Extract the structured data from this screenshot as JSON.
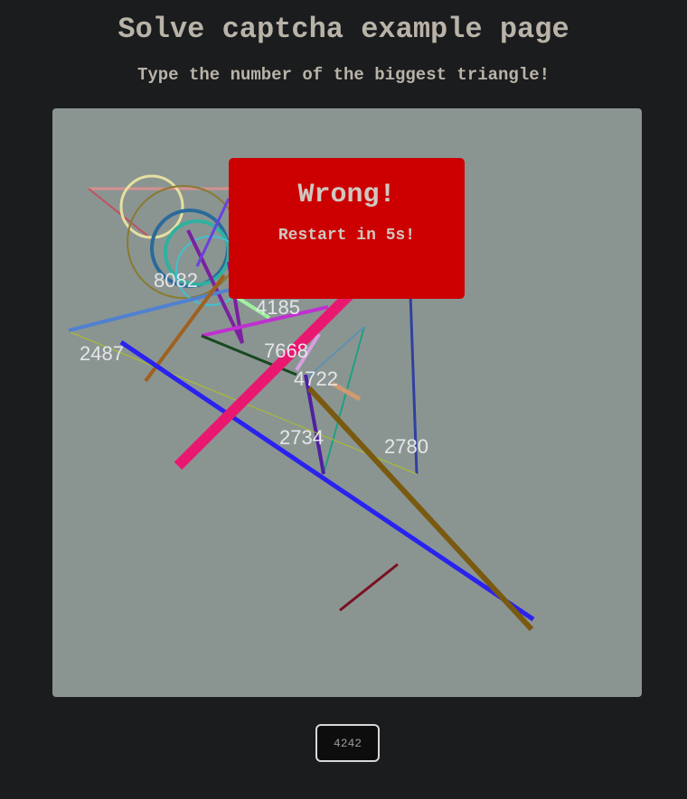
{
  "page": {
    "title": "Solve captcha example page",
    "instruction": "Type the number of the biggest triangle!"
  },
  "captcha": {
    "labels": [
      "8082",
      "4185",
      "2487",
      "7668",
      "4722",
      "2734",
      "2780"
    ],
    "label_color": "#e6e6ea"
  },
  "popup": {
    "heading": "Wrong!",
    "message": "Restart in 5s!",
    "background": "#cc0000"
  },
  "answer_input": {
    "value": "4242"
  }
}
